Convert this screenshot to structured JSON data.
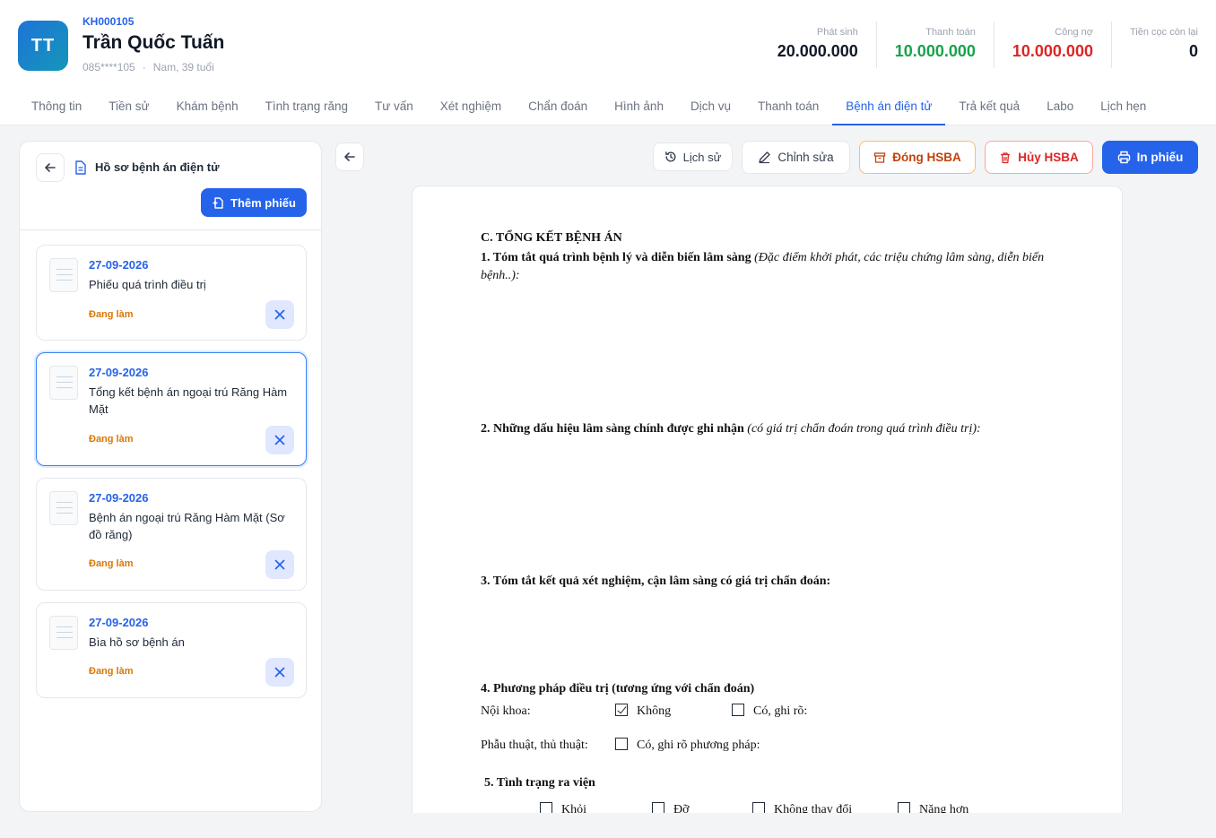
{
  "patient": {
    "initials": "TT",
    "code": "KH000105",
    "name": "Trần Quốc Tuấn",
    "phone": "085****105",
    "separator": "·",
    "info": "Nam, 39 tuổi"
  },
  "stats": [
    {
      "label": "Phát sinh",
      "value": "20.000.000",
      "color": "#111827"
    },
    {
      "label": "Thanh toán",
      "value": "10.000.000",
      "color": "#16a34a"
    },
    {
      "label": "Công nợ",
      "value": "10.000.000",
      "color": "#dc2626"
    },
    {
      "label": "Tiền cọc còn lại",
      "value": "0",
      "color": "#111827"
    }
  ],
  "tabs": [
    "Thông tin",
    "Tiền sử",
    "Khám bệnh",
    "Tình trạng răng",
    "Tư vấn",
    "Xét nghiệm",
    "Chẩn đoán",
    "Hình ảnh",
    "Dịch vụ",
    "Thanh toán",
    "Bệnh án điện tử",
    "Trả kết quả",
    "Labo",
    "Lịch hẹn"
  ],
  "active_tab": "Bệnh án điện tử",
  "sidebar": {
    "title": "Hồ sơ bệnh án điện tử",
    "add_label": "Thêm phiếu",
    "records": [
      {
        "date": "27-09-2026",
        "name": "Phiếu quá trình điều trị",
        "status": "Đang làm"
      },
      {
        "date": "27-09-2026",
        "name": "Tổng kết bệnh án ngoại trú Răng Hàm Mặt",
        "status": "Đang làm"
      },
      {
        "date": "27-09-2026",
        "name": "Bệnh án ngoại trú Răng Hàm Mặt (Sơ đồ răng)",
        "status": "Đang làm"
      },
      {
        "date": "27-09-2026",
        "name": "Bìa hồ sơ bệnh án",
        "status": "Đang làm"
      }
    ]
  },
  "toolbar": {
    "history": "Lịch sử",
    "edit": "Chỉnh sửa",
    "close": "Đóng HSBA",
    "cancel": "Hủy HSBA",
    "print": "In phiếu"
  },
  "document": {
    "section": "C. TỔNG KẾT BỆNH ÁN",
    "q1": "1. Tóm tắt quá trình bệnh lý và diễn biến lâm sàng",
    "q1_note": "(Đặc điểm khởi phát, các triệu chứng lâm sàng, diễn biến bệnh..):",
    "q2": "2. Những dấu hiệu lâm sàng chính được ghi nhận",
    "q2_note": "(có giá trị chẩn đoán trong quá trình điều trị):",
    "q3": "3. Tóm tắt kết quả xét nghiệm, cận lâm sàng có giá trị chẩn đoán:",
    "q4": "4. Phương pháp điều trị (tương ứng với chẩn đoán)",
    "internal_label": "Nội khoa:",
    "internal_no": "Không",
    "internal_no_checked": true,
    "internal_yes": "Có, ghi rõ:",
    "surgery_label": "Phẫu thuật, thủ thuật:",
    "surgery_yes": "Có, ghi rõ phương pháp:",
    "q5": "5. Tình trạng ra viện",
    "discharge": [
      "Khỏi",
      "Đỡ",
      "Không thay đổi",
      "Nặng hơn"
    ]
  }
}
